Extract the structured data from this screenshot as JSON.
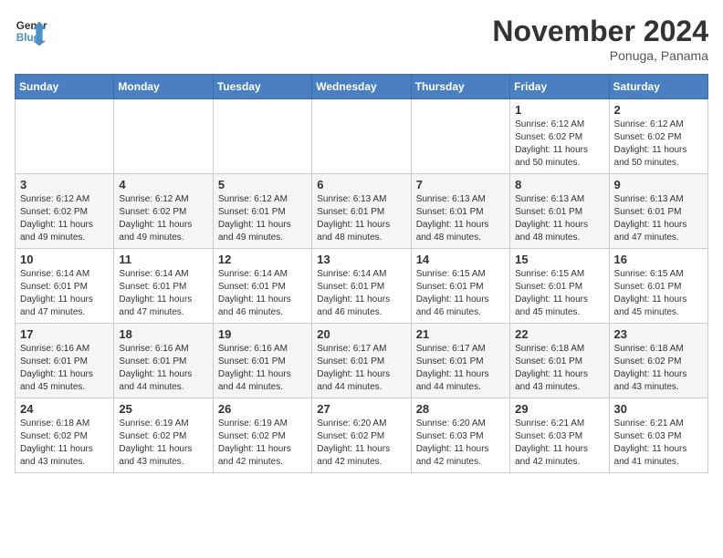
{
  "header": {
    "logo_text_general": "General",
    "logo_text_blue": "Blue",
    "month_title": "November 2024",
    "subtitle": "Ponuga, Panama"
  },
  "calendar": {
    "days_of_week": [
      "Sunday",
      "Monday",
      "Tuesday",
      "Wednesday",
      "Thursday",
      "Friday",
      "Saturday"
    ],
    "weeks": [
      [
        {
          "day": "",
          "info": ""
        },
        {
          "day": "",
          "info": ""
        },
        {
          "day": "",
          "info": ""
        },
        {
          "day": "",
          "info": ""
        },
        {
          "day": "",
          "info": ""
        },
        {
          "day": "1",
          "info": "Sunrise: 6:12 AM\nSunset: 6:02 PM\nDaylight: 11 hours and 50 minutes."
        },
        {
          "day": "2",
          "info": "Sunrise: 6:12 AM\nSunset: 6:02 PM\nDaylight: 11 hours and 50 minutes."
        }
      ],
      [
        {
          "day": "3",
          "info": "Sunrise: 6:12 AM\nSunset: 6:02 PM\nDaylight: 11 hours and 49 minutes."
        },
        {
          "day": "4",
          "info": "Sunrise: 6:12 AM\nSunset: 6:02 PM\nDaylight: 11 hours and 49 minutes."
        },
        {
          "day": "5",
          "info": "Sunrise: 6:12 AM\nSunset: 6:01 PM\nDaylight: 11 hours and 49 minutes."
        },
        {
          "day": "6",
          "info": "Sunrise: 6:13 AM\nSunset: 6:01 PM\nDaylight: 11 hours and 48 minutes."
        },
        {
          "day": "7",
          "info": "Sunrise: 6:13 AM\nSunset: 6:01 PM\nDaylight: 11 hours and 48 minutes."
        },
        {
          "day": "8",
          "info": "Sunrise: 6:13 AM\nSunset: 6:01 PM\nDaylight: 11 hours and 48 minutes."
        },
        {
          "day": "9",
          "info": "Sunrise: 6:13 AM\nSunset: 6:01 PM\nDaylight: 11 hours and 47 minutes."
        }
      ],
      [
        {
          "day": "10",
          "info": "Sunrise: 6:14 AM\nSunset: 6:01 PM\nDaylight: 11 hours and 47 minutes."
        },
        {
          "day": "11",
          "info": "Sunrise: 6:14 AM\nSunset: 6:01 PM\nDaylight: 11 hours and 47 minutes."
        },
        {
          "day": "12",
          "info": "Sunrise: 6:14 AM\nSunset: 6:01 PM\nDaylight: 11 hours and 46 minutes."
        },
        {
          "day": "13",
          "info": "Sunrise: 6:14 AM\nSunset: 6:01 PM\nDaylight: 11 hours and 46 minutes."
        },
        {
          "day": "14",
          "info": "Sunrise: 6:15 AM\nSunset: 6:01 PM\nDaylight: 11 hours and 46 minutes."
        },
        {
          "day": "15",
          "info": "Sunrise: 6:15 AM\nSunset: 6:01 PM\nDaylight: 11 hours and 45 minutes."
        },
        {
          "day": "16",
          "info": "Sunrise: 6:15 AM\nSunset: 6:01 PM\nDaylight: 11 hours and 45 minutes."
        }
      ],
      [
        {
          "day": "17",
          "info": "Sunrise: 6:16 AM\nSunset: 6:01 PM\nDaylight: 11 hours and 45 minutes."
        },
        {
          "day": "18",
          "info": "Sunrise: 6:16 AM\nSunset: 6:01 PM\nDaylight: 11 hours and 44 minutes."
        },
        {
          "day": "19",
          "info": "Sunrise: 6:16 AM\nSunset: 6:01 PM\nDaylight: 11 hours and 44 minutes."
        },
        {
          "day": "20",
          "info": "Sunrise: 6:17 AM\nSunset: 6:01 PM\nDaylight: 11 hours and 44 minutes."
        },
        {
          "day": "21",
          "info": "Sunrise: 6:17 AM\nSunset: 6:01 PM\nDaylight: 11 hours and 44 minutes."
        },
        {
          "day": "22",
          "info": "Sunrise: 6:18 AM\nSunset: 6:01 PM\nDaylight: 11 hours and 43 minutes."
        },
        {
          "day": "23",
          "info": "Sunrise: 6:18 AM\nSunset: 6:02 PM\nDaylight: 11 hours and 43 minutes."
        }
      ],
      [
        {
          "day": "24",
          "info": "Sunrise: 6:18 AM\nSunset: 6:02 PM\nDaylight: 11 hours and 43 minutes."
        },
        {
          "day": "25",
          "info": "Sunrise: 6:19 AM\nSunset: 6:02 PM\nDaylight: 11 hours and 43 minutes."
        },
        {
          "day": "26",
          "info": "Sunrise: 6:19 AM\nSunset: 6:02 PM\nDaylight: 11 hours and 42 minutes."
        },
        {
          "day": "27",
          "info": "Sunrise: 6:20 AM\nSunset: 6:02 PM\nDaylight: 11 hours and 42 minutes."
        },
        {
          "day": "28",
          "info": "Sunrise: 6:20 AM\nSunset: 6:03 PM\nDaylight: 11 hours and 42 minutes."
        },
        {
          "day": "29",
          "info": "Sunrise: 6:21 AM\nSunset: 6:03 PM\nDaylight: 11 hours and 42 minutes."
        },
        {
          "day": "30",
          "info": "Sunrise: 6:21 AM\nSunset: 6:03 PM\nDaylight: 11 hours and 41 minutes."
        }
      ]
    ]
  }
}
